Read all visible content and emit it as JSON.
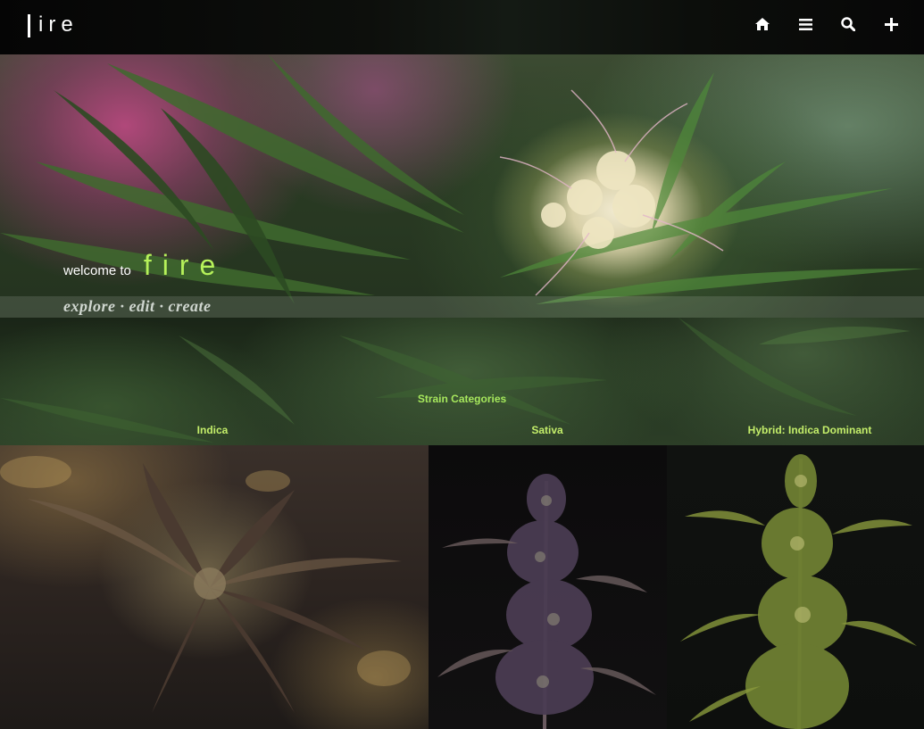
{
  "brand": {
    "logo_text": "ire"
  },
  "nav": {
    "icons": [
      "home-icon",
      "menu-icon",
      "search-icon",
      "plus-icon"
    ]
  },
  "hero": {
    "welcome_prefix": "welcome to",
    "welcome_brand": "fire",
    "tagline": "explore · edit · create"
  },
  "categories": {
    "title": "Strain Categories",
    "items": [
      {
        "label": "Indica"
      },
      {
        "label": "Sativa"
      },
      {
        "label": "Hybrid: Indica Dominant"
      }
    ]
  },
  "colors": {
    "accent_green": "#b6f15a",
    "category_label": "#c4ee6a",
    "topbar": "#0d0f0c"
  }
}
